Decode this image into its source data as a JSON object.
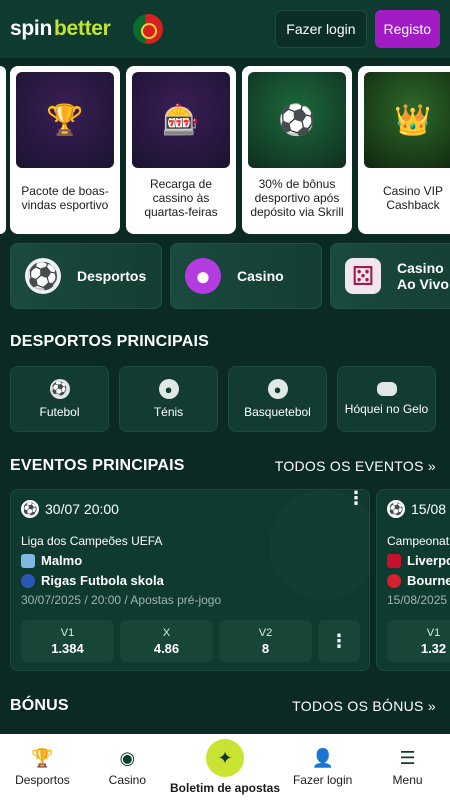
{
  "header": {
    "logo_spin": "spin",
    "logo_better": "better",
    "login_label": "Fazer login",
    "register_label": "Registo"
  },
  "promos": [
    {
      "text": "Pacote de boas-vindas esportivo",
      "icon": "trophy-icon"
    },
    {
      "text": "Recarga de cassino às quartas-feiras",
      "icon": "slot-777-icon"
    },
    {
      "text": "30% de bônus desportivo após depósito via Skrill",
      "icon": "skrill-icon"
    },
    {
      "text": "Casino VIP Cashback",
      "icon": "crown-icon"
    }
  ],
  "categories": [
    {
      "label": "Desportos",
      "icon": "soccer-ball-icon"
    },
    {
      "label": "Casino",
      "icon": "casino-chip-icon"
    },
    {
      "label": "Casino Ao Vivo",
      "icon": "dice-icon"
    }
  ],
  "sports_section": {
    "title": "DESPORTOS PRINCIPAIS",
    "items": [
      {
        "label": "Futebol",
        "icon": "football-icon"
      },
      {
        "label": "Ténis",
        "icon": "tennis-icon"
      },
      {
        "label": "Basquetebol",
        "icon": "basketball-icon"
      },
      {
        "label": "Hóquei no Gelo",
        "icon": "hockey-puck-icon"
      }
    ]
  },
  "events_section": {
    "title": "EVENTOS PRINCIPAIS",
    "link": "TODOS OS EVENTOS",
    "events": [
      {
        "date": "30/07 20:00",
        "league": "Liga dos Campeões UEFA",
        "team1": "Malmo",
        "team2": "Rigas Futbola skola",
        "meta": "30/07/2025 / 20:00 / Apostas pré-jogo",
        "odds": [
          {
            "label": "V1",
            "value": "1.384"
          },
          {
            "label": "X",
            "value": "4.86"
          },
          {
            "label": "V2",
            "value": "8"
          }
        ]
      },
      {
        "date": "15/08",
        "league": "Campeonat",
        "team1": "Liverpo",
        "team2": "Bourne",
        "meta": "15/08/2025",
        "odds": [
          {
            "label": "V1",
            "value": "1.32"
          }
        ]
      }
    ]
  },
  "bonus_section": {
    "title": "BÓNUS",
    "link": "TODOS OS BÓNUS"
  },
  "bottom_nav": [
    {
      "label": "Desportos",
      "icon": "trophy-icon"
    },
    {
      "label": "Casino",
      "icon": "casino-chip-icon"
    },
    {
      "label": "Boletim de apostas",
      "icon": "bet-slip-icon"
    },
    {
      "label": "Fazer login",
      "icon": "user-icon"
    },
    {
      "label": "Menu",
      "icon": "hamburger-icon"
    }
  ],
  "colors": {
    "background": "#0b2a23",
    "header": "#0f3a30",
    "register": "#a21cc5",
    "accent": "#c8e331"
  }
}
